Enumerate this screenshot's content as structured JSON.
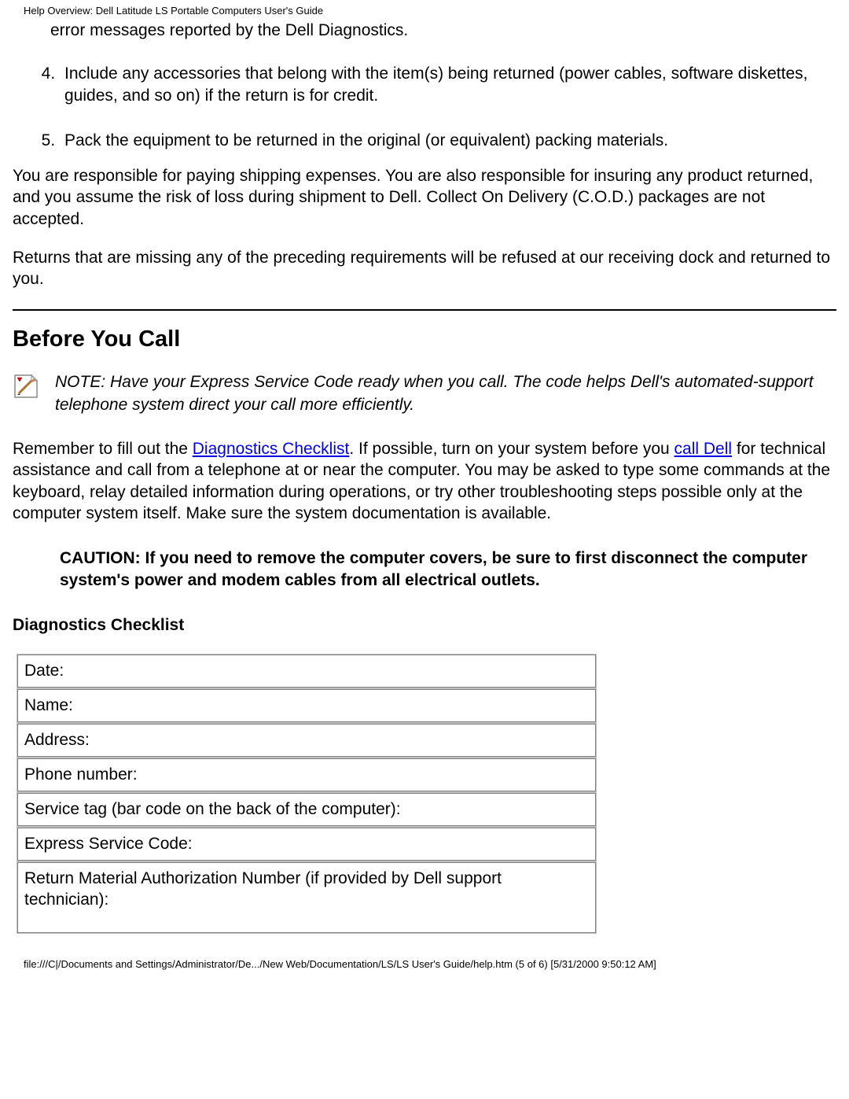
{
  "header": {
    "title": "Help Overview: Dell Latitude LS Portable Computers User's Guide"
  },
  "list": {
    "item3_partial": "error messages reported by the Dell Diagnostics.",
    "item4": "Include any accessories that belong with the item(s) being returned (power cables, software diskettes, guides, and so on) if the return is for credit.",
    "item5": "Pack the equipment to be returned in the original (or equivalent) packing materials."
  },
  "paragraphs": {
    "p1": "You are responsible for paying shipping expenses. You are also responsible for insuring any product returned, and you assume the risk of loss during shipment to Dell. Collect On Delivery (C.O.D.) packages are not accepted.",
    "p2": "Returns that are missing any of the preceding requirements will be refused at our receiving dock and returned to you."
  },
  "section": {
    "heading": "Before You Call",
    "note": "NOTE: Have your Express Service Code ready when you call. The code helps Dell's automated-support telephone system direct your call more efficiently.",
    "remember_a": "Remember to fill out the ",
    "link_diag": "Diagnostics Checklist",
    "remember_b": ". If possible, turn on your system before you ",
    "link_call": "call Dell",
    "remember_c": " for technical assistance and call from a telephone at or near the computer. You may be asked to type some commands at the keyboard, relay detailed information during operations, or try other troubleshooting steps possible only at the computer system itself. Make sure the system documentation is available.",
    "caution": "CAUTION: If you need to remove the computer covers, be sure to first disconnect the computer system's power and modem cables from all electrical outlets.",
    "sub_heading": "Diagnostics Checklist"
  },
  "checklist": {
    "r1": "Date:",
    "r2": "Name:",
    "r3": "Address:",
    "r4": "Phone number:",
    "r5": "Service tag (bar code on the back of the computer):",
    "r6": "Express Service Code:",
    "r7": "Return Material Authorization Number (if provided by Dell support technician):"
  },
  "footer": {
    "text": "file:///C|/Documents and Settings/Administrator/De.../New Web/Documentation/LS/LS User's Guide/help.htm (5 of 6) [5/31/2000 9:50:12 AM]"
  }
}
